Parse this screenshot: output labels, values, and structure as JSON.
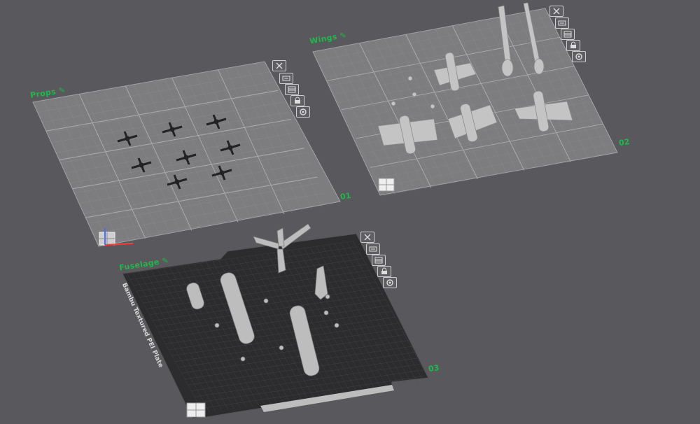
{
  "plates": [
    {
      "label": "Props",
      "number": "01"
    },
    {
      "label": "Wings",
      "number": "02"
    },
    {
      "label": "Fuselage",
      "number": "03",
      "surface": "Bambu Textured PEI Plate"
    }
  ],
  "plate_toolbar_icons": [
    "close-icon",
    "auto-arrange-icon",
    "layout-grid-icon",
    "lock-icon",
    "settings-icon"
  ],
  "colors": {
    "background": "#58585d",
    "plate_light": "#7d7d80",
    "plate_dark": "#2c2c2e",
    "label_green": "#1fb84a",
    "model_gray": "#bdbdbd",
    "prop_black": "#222222"
  }
}
